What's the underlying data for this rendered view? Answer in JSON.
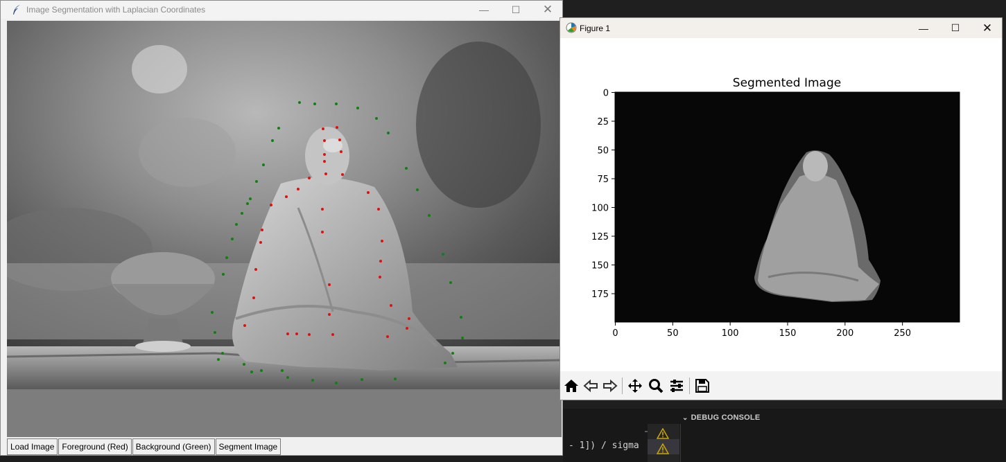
{
  "tk_window": {
    "title": "Image Segmentation with Laplacian Coordinates",
    "buttons": {
      "load": "Load Image",
      "foreground": "Foreground (Red)",
      "background": "Background (Green)",
      "segment": "Segment Image"
    }
  },
  "figure_window": {
    "title": "Figure 1",
    "toolbar_icons": [
      "home-icon",
      "back-icon",
      "forward-icon",
      "pan-icon",
      "zoom-icon",
      "configure-subplots-icon",
      "save-icon"
    ]
  },
  "chart_data": {
    "type": "image",
    "title": "Segmented Image",
    "xticks": [
      0,
      50,
      100,
      150,
      200,
      250
    ],
    "yticks": [
      0,
      25,
      50,
      75,
      100,
      125,
      150,
      175
    ],
    "xlim": [
      0,
      300
    ],
    "ylim": [
      200,
      0
    ],
    "background_color": "#000000"
  },
  "editor": {
    "debug_console_label": "DEBUG CONSOLE",
    "code_text": "- 1]) / sigma"
  },
  "colors": {
    "foreground_marker": "#e01010",
    "background_marker": "#108010"
  }
}
